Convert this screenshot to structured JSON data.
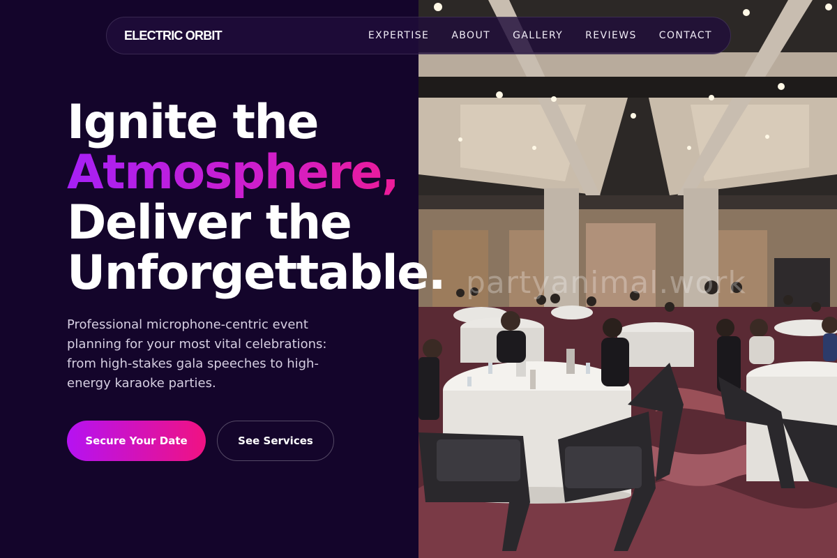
{
  "header": {
    "brand": "ELECTRIC ORBIT",
    "nav": [
      "EXPERTISE",
      "ABOUT",
      "GALLERY",
      "REVIEWS",
      "CONTACT"
    ]
  },
  "hero": {
    "headline_line1": "Ignite the",
    "headline_accent": "Atmosphere,",
    "headline_line3": "Deliver the",
    "headline_line4": "Unforgettable.",
    "subtitle": "Professional microphone-centric event planning for your most vital celebrations: from high-stakes gala speeches to high-energy karaoke parties.",
    "primary_button": "Secure Your Date",
    "secondary_button": "See Services"
  },
  "photo": {
    "watermark": "partyanimal.work"
  },
  "colors": {
    "background": "#14052b",
    "accent_start": "#a620f6",
    "accent_end": "#ff1a74"
  }
}
